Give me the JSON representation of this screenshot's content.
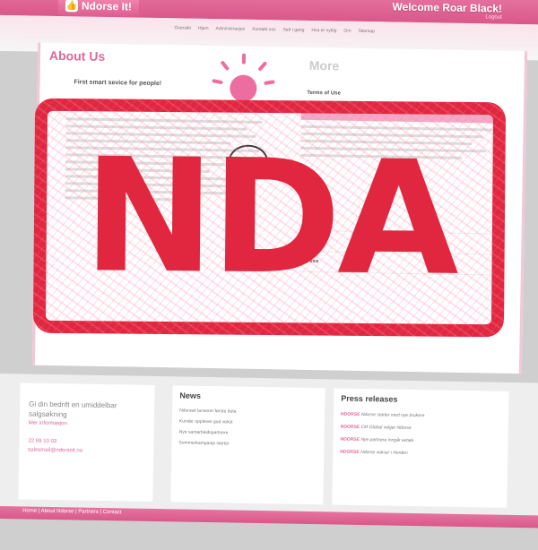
{
  "header": {
    "logo_text": "Ndorse It!",
    "welcome": "Welcome Roar Black!",
    "logout": "Logout",
    "nav_links": [
      "Oversikt",
      "Hjem",
      "Administrasjon",
      "Kontakt oss",
      "Sett i gang",
      "Hva er nyttig",
      "Om",
      "Sitemap"
    ]
  },
  "about": {
    "title": "About Us",
    "subtitle": "First smart sevice for people!"
  },
  "more": {
    "title": "More",
    "items": [
      "Terms of Use",
      "History",
      "Family",
      "2011",
      "Press"
    ]
  },
  "stamp": {
    "text": "NDA"
  },
  "contact_box": {
    "title": "Gi din bedrift en umiddelbar salgsøkning",
    "link": "Mer informasjon",
    "phone": "22 89 10 03",
    "email": "salesmail@ndorseit.no"
  },
  "news": {
    "title": "News",
    "items": [
      "Ndorseit lanserer første beta",
      "Kunder opplever god vekst",
      "Nye samarbeidspartnere",
      "Sommerkampanje starter"
    ]
  },
  "press": {
    "title": "Press releases",
    "items": [
      {
        "tag": "NDORSE",
        "text": "Ndorse starter med nye brukere"
      },
      {
        "tag": "NDORSE",
        "text": "CM Global velger Ndorse"
      },
      {
        "tag": "NDORSE",
        "text": "Nye partnere inngår avtale"
      },
      {
        "tag": "NDORSE",
        "text": "Ndorse vokser i Norden"
      }
    ]
  },
  "footer": {
    "links": "Home | About Ndorse | Partners | Contact"
  },
  "colors": {
    "brand_pink": "#e0679a",
    "stamp_red": "#e0273f"
  }
}
